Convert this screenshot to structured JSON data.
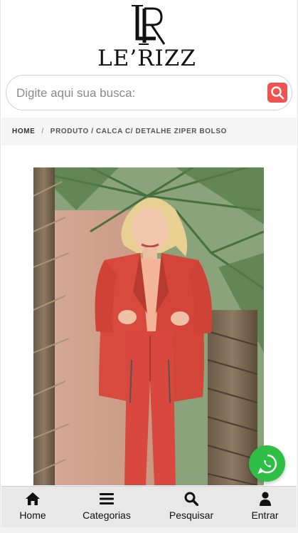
{
  "brand": {
    "name": "LE’RIZZ",
    "monogram": "LR"
  },
  "search": {
    "placeholder": "Digite aqui sua busca:",
    "value": ""
  },
  "breadcrumb": {
    "home": "HOME",
    "separator": "/",
    "current": "PRODUTO / CALCA C/ DETALHE ZIPER BOLSO"
  },
  "product": {
    "image_icon": "product-photo"
  },
  "whatsapp": {
    "icon": "whatsapp-icon"
  },
  "bottom_nav": {
    "items": [
      {
        "label": "Home",
        "icon": "home-icon"
      },
      {
        "label": "Categorias",
        "icon": "menu-icon"
      },
      {
        "label": "Pesquisar",
        "icon": "search-icon"
      },
      {
        "label": "Entrar",
        "icon": "user-icon"
      }
    ]
  },
  "colors": {
    "accent": "#ef5350",
    "whatsapp": "#2fbf46",
    "nav_bg": "#e8e8e8"
  }
}
